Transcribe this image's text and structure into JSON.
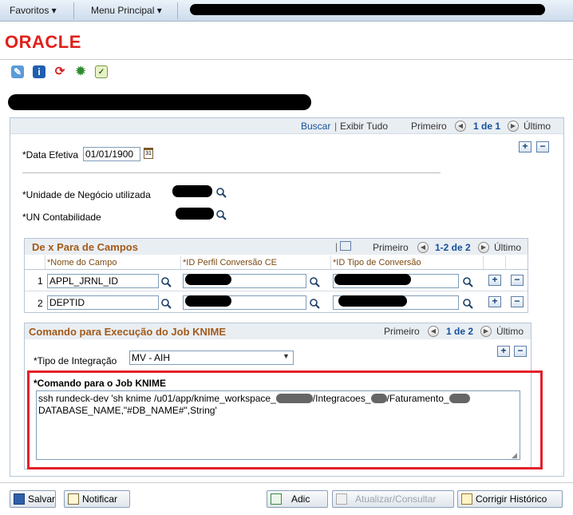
{
  "topbar": {
    "favorites": "Favoritos ▾",
    "main_menu": "Menu Principal ▾"
  },
  "brand": {
    "logo": "ORACLE"
  },
  "toolbar": {
    "icons": [
      "edit-icon",
      "info-icon",
      "refresh-icon",
      "settings-icon",
      "report-icon"
    ]
  },
  "nav": {
    "search": "Buscar",
    "view_all": "Exibir Tudo",
    "first": "Primeiro",
    "range": "1 de 1",
    "last": "Último"
  },
  "form": {
    "effective_date_label": "*Data Efetiva",
    "effective_date_value": "01/01/1900",
    "business_unit_label": "*Unidade de Negócio utilizada",
    "accounting_unit_label": "*UN Contabilidade"
  },
  "mapping_grid": {
    "title": "De x Para de Campos",
    "first": "Primeiro",
    "range": "1-2 de 2",
    "last": "Último",
    "columns": [
      "*Nome do Campo",
      "*ID Perfil Conversão CE",
      "*ID Tipo de Conversão"
    ],
    "rows": [
      {
        "num": "1",
        "field": "APPL_JRNL_ID"
      },
      {
        "num": "2",
        "field": "DEPTID"
      }
    ]
  },
  "job": {
    "title": "Comando para Execução do Job KNIME",
    "first": "Primeiro",
    "range": "1 de 2",
    "last": "Último",
    "integration_label": "*Tipo de Integração",
    "integration_value": "MV - AIH",
    "command_label": "*Comando para o Job KNIME",
    "command_line1": "ssh rundeck-dev 'sh knime /u01/app/knime_workspace_",
    "command_line1b": "/Integracoes_",
    "command_line1c": "/Faturamento_",
    "command_line2": "DATABASE_NAME,\"#DB_NAME#\",String'"
  },
  "footer": {
    "save": "Salvar",
    "notify": "Notificar",
    "add": "Adic",
    "update": "Atualizar/Consultar",
    "correct_history": "Corrigir Histórico"
  },
  "colors": {
    "accent_red": "#e3202a",
    "link_blue": "#14509a",
    "section_title": "#a35a1a"
  }
}
